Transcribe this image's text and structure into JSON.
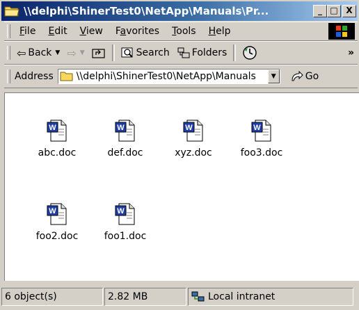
{
  "window": {
    "title": "\\\\delphi\\ShinerTest0\\NetApp\\Manuals\\Pr...",
    "minimize_glyph": "_",
    "maximize_glyph": "□",
    "close_glyph": "X"
  },
  "menubar": {
    "items": [
      {
        "label": "File",
        "u": "F",
        "rest": "ile"
      },
      {
        "label": "Edit",
        "u": "E",
        "rest": "dit"
      },
      {
        "label": "View",
        "u": "V",
        "rest": "iew"
      },
      {
        "label": "Favorites",
        "u": "a",
        "pre": "F",
        "rest": "vorites"
      },
      {
        "label": "Tools",
        "u": "T",
        "rest": "ools"
      },
      {
        "label": "Help",
        "u": "H",
        "rest": "elp"
      }
    ]
  },
  "toolbar": {
    "back_label": "Back",
    "search_label": "Search",
    "folders_label": "Folders",
    "overflow": "»"
  },
  "address": {
    "label": "Address",
    "value": "\\\\delphi\\ShinerTest0\\NetApp\\Manuals",
    "go_label": "Go"
  },
  "files": [
    {
      "name": "abc.doc",
      "icon": "word-document-icon"
    },
    {
      "name": "def.doc",
      "icon": "word-document-icon"
    },
    {
      "name": "xyz.doc",
      "icon": "word-document-icon"
    },
    {
      "name": "foo3.doc",
      "icon": "word-document-icon"
    },
    {
      "name": "foo2.doc",
      "icon": "word-document-icon"
    },
    {
      "name": "foo1.doc",
      "icon": "word-document-icon"
    }
  ],
  "status": {
    "objects": "6 object(s)",
    "size": "2.82 MB",
    "zone": "Local intranet"
  },
  "colors": {
    "title_start": "#0a246a",
    "title_end": "#a6caf0",
    "chrome": "#d4d0c8",
    "word_blue": "#1f3fa8"
  }
}
